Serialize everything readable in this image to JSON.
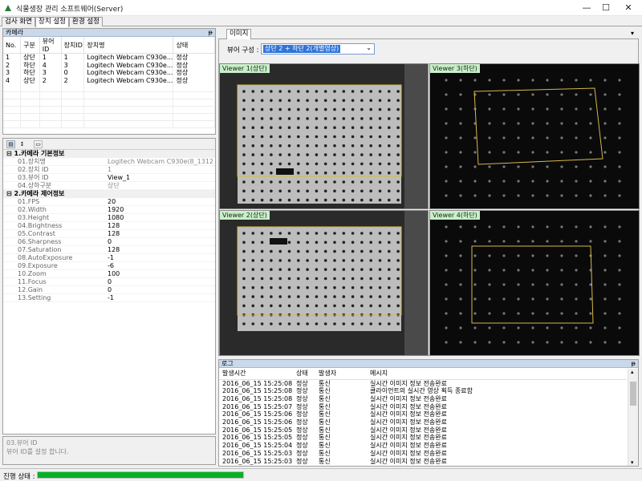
{
  "window": {
    "title": "식물생장 관리 소프트웨어(Server)",
    "minimize": "—",
    "maximize": "☐",
    "close": "✕"
  },
  "menu_tabs": [
    "검사 화면",
    "장치 설정",
    "환경 설정"
  ],
  "camera_panel": {
    "title": "카메라",
    "pin": "ᵽ",
    "columns": [
      "No.",
      "구분",
      "뷰어ID",
      "장치ID",
      "장치명",
      "상태"
    ],
    "rows": [
      [
        "1",
        "상단",
        "1",
        "1",
        "Logitech Webcam C930e...",
        "정상"
      ],
      [
        "2",
        "하단",
        "4",
        "3",
        "Logitech Webcam C930e...",
        "정상"
      ],
      [
        "3",
        "하단",
        "3",
        "0",
        "Logitech Webcam C930e...",
        "정상"
      ],
      [
        "4",
        "상단",
        "2",
        "2",
        "Logitech Webcam C930e...",
        "정상"
      ]
    ]
  },
  "properties": {
    "categories": [
      {
        "name": "1.카메라 기본정보",
        "items": [
          {
            "key": "01.장치명",
            "value": "Logitech Webcam C930e(8_1312880...",
            "grey": true
          },
          {
            "key": "02.장치 ID",
            "value": "1",
            "grey": true
          },
          {
            "key": "03.뷰어 ID",
            "value": "View_1",
            "grey": false
          },
          {
            "key": "04.상하구분",
            "value": "상단",
            "grey": true
          }
        ]
      },
      {
        "name": "2.카메라 제어정보",
        "items": [
          {
            "key": "01.FPS",
            "value": "20"
          },
          {
            "key": "02.Width",
            "value": "1920"
          },
          {
            "key": "03.Height",
            "value": "1080"
          },
          {
            "key": "04.Brightness",
            "value": "128"
          },
          {
            "key": "05.Contrast",
            "value": "128"
          },
          {
            "key": "06.Sharpness",
            "value": "0"
          },
          {
            "key": "07.Saturation",
            "value": "128"
          },
          {
            "key": "08.AutoExposure",
            "value": "-1"
          },
          {
            "key": "09.Exposure",
            "value": "-6"
          },
          {
            "key": "10.Zoom",
            "value": "100"
          },
          {
            "key": "11.Focus",
            "value": "0"
          },
          {
            "key": "12.Gain",
            "value": "0"
          },
          {
            "key": "13.Setting",
            "value": "-1"
          }
        ]
      }
    ],
    "description_title": "03.뷰어 ID",
    "description_text": "뷰어 ID를 설정 합니다."
  },
  "image_panel": {
    "tab": "이미지",
    "viewer_config_label": "뷰어 구성 :",
    "viewer_config_value": "상단 2 + 하단 2(개별영상)",
    "viewers": [
      {
        "label": "Viewer 1(상단)"
      },
      {
        "label": "Viewer 3(하단)"
      },
      {
        "label": "Viewer 2(상단)"
      },
      {
        "label": "Viewer 4(하단)"
      }
    ]
  },
  "log_panel": {
    "title": "로그",
    "pin": "ᵽ",
    "columns": [
      "발생시간",
      "상태",
      "발생자",
      "메시지"
    ],
    "rows": [
      [
        "2016_06_15 15:25:08,558",
        "정상",
        "통신",
        "실시간 이미지 정보 전송완료"
      ],
      [
        "2016_06_15 15:25:08,306",
        "정상",
        "통신",
        "클라이언트의 실시간 영상 획득 종료함"
      ],
      [
        "2016_06_15 15:25:08,004",
        "정상",
        "통신",
        "실시간 이미지 정보 전송완료"
      ],
      [
        "2016_06_15 15:25:07,446",
        "정상",
        "통신",
        "실시간 이미지 정보 전송완료"
      ],
      [
        "2016_06_15 15:25:06,818",
        "정상",
        "통신",
        "실시간 이미지 정보 전송완료"
      ],
      [
        "2016_06_15 15:25:06,285",
        "정상",
        "통신",
        "실시간 이미지 정보 전송완료"
      ],
      [
        "2016_06_15 15:25:05,648",
        "정상",
        "통신",
        "실시간 이미지 정보 전송완료"
      ],
      [
        "2016_06_15 15:25:05,119",
        "정상",
        "통신",
        "실시간 이미지 정보 전송완료"
      ],
      [
        "2016_06_15 15:25:04,504",
        "정상",
        "통신",
        "실시간 이미지 정보 전송완료"
      ],
      [
        "2016_06_15 15:25:03,889",
        "정상",
        "통신",
        "실시간 이미지 정보 전송완료"
      ],
      [
        "2016_06_15 15:25:03,299",
        "정상",
        "통신",
        "실시간 이미지 정보 전송완료"
      ]
    ]
  },
  "status_bar": {
    "label": "진행 상태 :",
    "progress": 1.0,
    "progress_color": "#06b025"
  }
}
